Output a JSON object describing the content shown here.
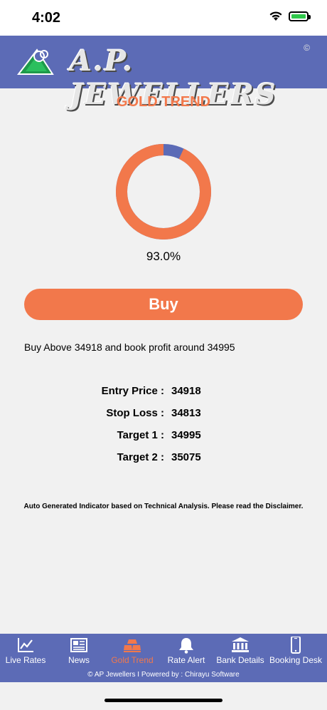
{
  "status_bar": {
    "time": "4:02"
  },
  "header": {
    "brand": "A.P. JEWELLERS",
    "copyright_mark": "©"
  },
  "page": {
    "title": "GOLD TREND",
    "donut": {
      "buy_percent": 93.0,
      "buy_color": "#f2784b",
      "sell_color": "#5c6bb6"
    },
    "percent_label": "93.0%",
    "action_label": "Buy",
    "advice": "Buy Above 34918 and book profit around 34995",
    "levels": [
      {
        "label": "Entry Price :",
        "value": "34918"
      },
      {
        "label": "Stop Loss :",
        "value": "34813"
      },
      {
        "label": "Target 1 :",
        "value": "34995"
      },
      {
        "label": "Target 2 :",
        "value": "35075"
      }
    ],
    "disclaimer": "Auto Generated Indicator based on Technical Analysis. Please read the Disclaimer."
  },
  "tabbar": {
    "tabs": [
      {
        "label": "Live Rates",
        "icon": "line-chart-icon"
      },
      {
        "label": "News",
        "icon": "newspaper-icon"
      },
      {
        "label": "Gold Trend",
        "icon": "gold-bars-icon",
        "active": true
      },
      {
        "label": "Rate Alert",
        "icon": "bell-icon"
      },
      {
        "label": "Bank Details",
        "icon": "bank-icon"
      },
      {
        "label": "Booking Desk",
        "icon": "phone-icon"
      }
    ],
    "footer": "© AP Jewellers I  Powered by : Chirayu Software"
  },
  "colors": {
    "accent": "#f2784b",
    "brand_blue": "#5c6bb6",
    "background": "#f1f1f1"
  }
}
